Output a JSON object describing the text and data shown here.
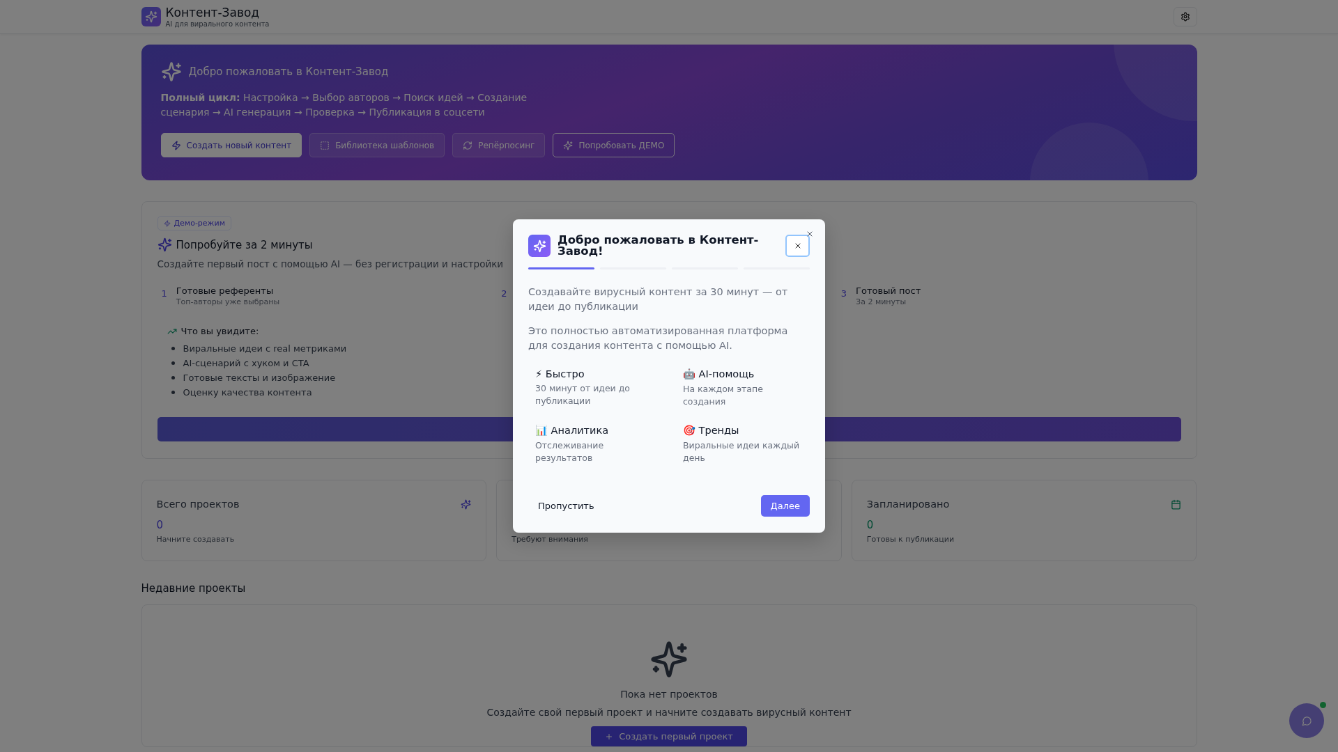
{
  "header": {
    "title": "Контент-Завод",
    "subtitle": "AI для вирального контента"
  },
  "hero": {
    "title": "Добро пожаловать в Контент-Завод",
    "description": "**Полный цикл:** Настройка → Выбор авторов → Поиск идей → Создание сценария → AI генерация → Проверка → Публикация в соцсети",
    "actions": [
      {
        "label": "Создать новый контент",
        "kind": "primary"
      },
      {
        "label": "Библиотека шаблонов",
        "kind": "secondary"
      },
      {
        "label": "Репёрпосинг",
        "kind": "secondary"
      },
      {
        "label": "Попробовать ДЕМО",
        "kind": "outline"
      }
    ]
  },
  "demo": {
    "badge": "Демо-режим",
    "title": "Попробуйте за 2 минуты",
    "description": "Создайте первый пост с помощью AI — без регистрации и настройки",
    "steps": [
      {
        "number": "1",
        "title": "Готовые референты",
        "subtitle": "Топ-авторы уже выбраны"
      },
      {
        "number": "2"
      },
      {
        "number": "3",
        "title": "Готовый пост",
        "subtitle": "За 2 минуты"
      }
    ],
    "preview_title": "Что вы увидите:",
    "preview_items": [
      "Виральные идеи с real метриками",
      "AI-сценарий с хуком и CTA",
      "Готовые тексты и изображение",
      "Оценку качества контента"
    ]
  },
  "stats": [
    {
      "kind": "total",
      "title": "Всего проектов",
      "value": "0",
      "subtitle": "Начните создавать"
    },
    {
      "kind": "attention",
      "subtitle": "Требуют внимания"
    },
    {
      "kind": "scheduled",
      "title": "Запланировано",
      "value": "0",
      "subtitle": "Готовы к публикации"
    }
  ],
  "recent": {
    "title": "Недавние проекты",
    "empty_title": "Пока нет проектов",
    "empty_text": "Создайте свой первый проект и начните создавать вирусный контент",
    "action": "Создать первый проект"
  },
  "chat": {
    "online": true
  },
  "modal": {
    "title": "Добро пожаловать в Контент-Завод!",
    "progress": [
      {
        "selected": true
      },
      {
        "selected": false
      },
      {
        "selected": false
      },
      {
        "selected": false
      }
    ],
    "paragraphs": [
      "Создавайте вирусный контент за 30 минут — от идеи до публикации",
      "Это полностью автоматизированная платформа для создания контента с помощью AI."
    ],
    "features": [
      {
        "title": "⚡ Быстро",
        "text": "30 минут от идеи до публикации"
      },
      {
        "title": "🤖 AI-помощь",
        "text": "На каждом этапе создания"
      },
      {
        "title": "📊 Аналитика",
        "text": "Отслеживание результатов"
      },
      {
        "title": "🎯 Тренды",
        "text": "Виральные идеи каждый день"
      }
    ],
    "secondary_action": "Пропустить",
    "primary_action": "Далее"
  }
}
